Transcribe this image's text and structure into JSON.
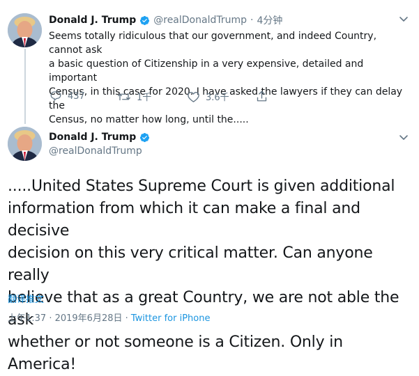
{
  "tweet1": {
    "display_name": "Donald J. Trump",
    "handle": "@realDonaldTrump",
    "separator": "·",
    "time_ago": "4分钟",
    "text_lines": [
      "Seems totally ridiculous that our government, and indeed Country, cannot ask",
      "a basic question of Citizenship in a very expensive, detailed and important",
      "Census, in this case for 2020. I have asked the lawyers if they can delay the",
      "Census, no matter how long, until the....."
    ],
    "actions": {
      "replies": "437",
      "retweets": "1千",
      "likes": "3.6千"
    }
  },
  "tweet2": {
    "display_name": "Donald J. Trump",
    "handle": "@realDonaldTrump",
    "text_lines": [
      ".....United States Supreme Court is given additional",
      "information from which it can make a final and decisive",
      "decision on this very critical matter. Can anyone really",
      "believe that as a great Country, we are not able the ask",
      "whether or not someone is a Citizen. Only in America!"
    ],
    "translate_link": "翻译推文",
    "timestamp": "上午1:37 · 2019年6月28日 · ",
    "source": "Twitter for iPhone"
  },
  "icons": {
    "verified": "verified-badge-icon",
    "reply": "reply-icon",
    "retweet": "retweet-icon",
    "like": "heart-icon",
    "share": "share-icon",
    "menu": "chevron-down-icon"
  },
  "colors": {
    "verified_blue": "#1da1f2",
    "link_blue": "#1b95e0",
    "muted_gray": "#657786",
    "thread_line": "#ccd6dd"
  }
}
